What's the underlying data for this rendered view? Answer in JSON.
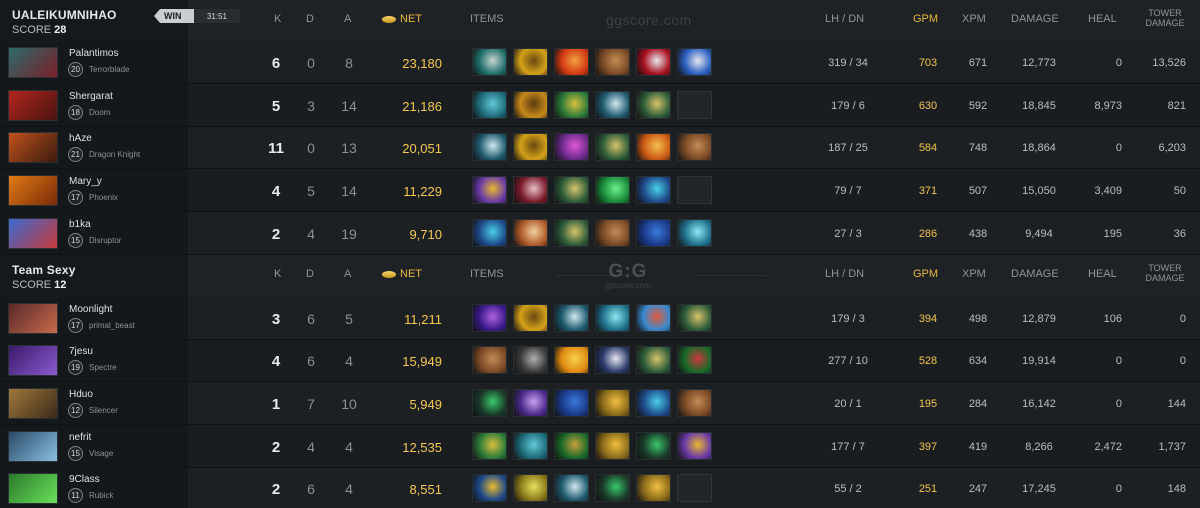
{
  "headers": {
    "k": "K",
    "d": "D",
    "a": "A",
    "net": "NET",
    "items": "ITEMS",
    "lhdn": "LH / DN",
    "gpm": "GPM",
    "xpm": "XPM",
    "damage": "DAMAGE",
    "heal": "HEAL",
    "tower_line1": "TOWER",
    "tower_line2": "DAMAGE"
  },
  "watermark": "ggscore.com",
  "logo": {
    "big": "G:G",
    "small": "ggscore.com"
  },
  "teams": [
    {
      "name": "UALEIKUMNIHAO",
      "score_label": "SCORE",
      "score": "28",
      "result": "WIN",
      "duration": "31:51",
      "players": [
        {
          "name": "Palantimos",
          "level": "20",
          "hero": "Terrorblade",
          "k": "6",
          "d": "0",
          "a": "8",
          "net": "23,180",
          "lhdn": "319 / 34",
          "gpm": "703",
          "xpm": "671",
          "damage": "12,773",
          "heal": "0",
          "tower": "13,526",
          "portrait": [
            "#2b6b6a",
            "#7a1f2a"
          ],
          "items": [
            [
              "#1f6f6a",
              "#c9d4d0"
            ],
            [
              "#d4a21a",
              "#6b4a10"
            ],
            [
              "#d33a12",
              "#f2a040"
            ],
            [
              "#7a4a26",
              "#c48a55"
            ],
            [
              "#a8101e",
              "#e8e8ee"
            ],
            [
              "#2a5fbf",
              "#e6e6f0"
            ]
          ]
        },
        {
          "name": "Shergarat",
          "level": "18",
          "hero": "Doom",
          "k": "5",
          "d": "3",
          "a": "14",
          "net": "21,186",
          "lhdn": "179 / 6",
          "gpm": "630",
          "xpm": "592",
          "damage": "18,845",
          "heal": "8,973",
          "tower": "821",
          "portrait": [
            "#b3261e",
            "#4a1410"
          ],
          "items": [
            [
              "#1e6b7a",
              "#63c8d8"
            ],
            [
              "#c8891a",
              "#5a3a10"
            ],
            [
              "#2c7a3a",
              "#d8c040"
            ],
            [
              "#1f5a6e",
              "#cfe8f0"
            ],
            [
              "#2e5c3a",
              "#d6c36a"
            ],
            null
          ]
        },
        {
          "name": "hAze",
          "level": "21",
          "hero": "Dragon Knight",
          "k": "11",
          "d": "0",
          "a": "13",
          "net": "20,051",
          "lhdn": "187 / 25",
          "gpm": "584",
          "xpm": "748",
          "damage": "18,864",
          "heal": "0",
          "tower": "6,203",
          "portrait": [
            "#c0521c",
            "#3a1a10"
          ],
          "items": [
            [
              "#1f5a6e",
              "#cfe8f0"
            ],
            [
              "#d4a21a",
              "#6b4a10"
            ],
            [
              "#6a2a8a",
              "#e058d8"
            ],
            [
              "#2e5c3a",
              "#d6c36a"
            ],
            [
              "#cc5a14",
              "#f4c050"
            ],
            [
              "#7a4a26",
              "#c48a55"
            ]
          ]
        },
        {
          "name": "Mary_y",
          "level": "17",
          "hero": "Phoenix",
          "k": "4",
          "d": "5",
          "a": "14",
          "net": "11,229",
          "lhdn": "79 / 7",
          "gpm": "371",
          "xpm": "507",
          "damage": "15,050",
          "heal": "3,409",
          "tower": "50",
          "portrait": [
            "#e07a14",
            "#7a2a0a"
          ],
          "items": [
            [
              "#6a3aa8",
              "#e8b830"
            ],
            [
              "#7a1a2a",
              "#e8c0c8"
            ],
            [
              "#2e5c3a",
              "#d6c36a"
            ],
            [
              "#1a8a3a",
              "#6af08a"
            ],
            [
              "#1e4a8a",
              "#4ad0e8"
            ],
            null
          ]
        },
        {
          "name": "b1ka",
          "level": "15",
          "hero": "Disruptor",
          "k": "2",
          "d": "4",
          "a": "19",
          "net": "9,710",
          "lhdn": "27 / 3",
          "gpm": "286",
          "xpm": "438",
          "damage": "9,494",
          "heal": "195",
          "tower": "36",
          "portrait": [
            "#3a6ad0",
            "#c83a3a"
          ],
          "items": [
            [
              "#1e4a8a",
              "#4ad0e8"
            ],
            [
              "#b05a2a",
              "#f0d0a0"
            ],
            [
              "#2e5c3a",
              "#d6c36a"
            ],
            [
              "#7a4a26",
              "#c48a55"
            ],
            [
              "#1a3a8a",
              "#3a7ad8"
            ],
            [
              "#1f6f8a",
              "#8ae8f0"
            ]
          ]
        }
      ]
    },
    {
      "name": "Team Sexy",
      "score_label": "SCORE",
      "score": "12",
      "players": [
        {
          "name": "Moonlight",
          "level": "17",
          "hero": "primal_beast",
          "k": "3",
          "d": "6",
          "a": "5",
          "net": "11,211",
          "lhdn": "179 / 3",
          "gpm": "394",
          "xpm": "498",
          "damage": "12,879",
          "heal": "106",
          "tower": "0",
          "portrait": [
            "#5a2a2a",
            "#c86a4a"
          ],
          "items": [
            [
              "#3a1a8a",
              "#b060e0"
            ],
            [
              "#d4a21a",
              "#6b4a10"
            ],
            [
              "#1f5a6e",
              "#cfe8f0"
            ],
            [
              "#1f6f8a",
              "#8ae8f0"
            ],
            [
              "#3a8ad0",
              "#e05a3a"
            ],
            [
              "#2e5c3a",
              "#d6c36a"
            ]
          ]
        },
        {
          "name": "7jesu",
          "level": "19",
          "hero": "Spectre",
          "k": "4",
          "d": "6",
          "a": "4",
          "net": "15,949",
          "lhdn": "277 / 10",
          "gpm": "528",
          "xpm": "634",
          "damage": "19,914",
          "heal": "0",
          "tower": "0",
          "portrait": [
            "#3a1a6a",
            "#8a5ad0"
          ],
          "items": [
            [
              "#7a4a26",
              "#c48a55"
            ],
            [
              "#3a3a3a",
              "#b0b0b0"
            ],
            [
              "#e08a10",
              "#f8d050"
            ],
            [
              "#2a3a6a",
              "#e6e6f0"
            ],
            [
              "#2e5c3a",
              "#d6c36a"
            ],
            [
              "#1a6a2a",
              "#c83a3a"
            ]
          ]
        },
        {
          "name": "Hduo",
          "level": "12",
          "hero": "Silencer",
          "k": "1",
          "d": "7",
          "a": "10",
          "net": "5,949",
          "lhdn": "20 / 1",
          "gpm": "195",
          "xpm": "284",
          "damage": "16,142",
          "heal": "0",
          "tower": "144",
          "portrait": [
            "#a0783a",
            "#3a2a1a"
          ],
          "items": [
            [
              "#1a3a2a",
              "#3ac86a"
            ],
            [
              "#4a2a8a",
              "#c8a0f0"
            ],
            [
              "#1a3a8a",
              "#3a7ad8"
            ],
            [
              "#8a6a1a",
              "#f0c040"
            ],
            [
              "#1e4a8a",
              "#4ad0e8"
            ],
            [
              "#7a4a26",
              "#c48a55"
            ]
          ]
        },
        {
          "name": "nefrit",
          "level": "15",
          "hero": "Visage",
          "k": "2",
          "d": "4",
          "a": "4",
          "net": "12,535",
          "lhdn": "177 / 7",
          "gpm": "397",
          "xpm": "419",
          "damage": "8,266",
          "heal": "2,472",
          "tower": "1,737",
          "portrait": [
            "#2a4a6a",
            "#8ac0e0"
          ],
          "items": [
            [
              "#2c7a3a",
              "#d8c040"
            ],
            [
              "#1e6b7a",
              "#63c8d8"
            ],
            [
              "#1a6a2a",
              "#c8a03a"
            ],
            [
              "#8a6a1a",
              "#f0c040"
            ],
            [
              "#1a3a2a",
              "#3ac86a"
            ],
            [
              "#6a3aa8",
              "#e8b830"
            ]
          ]
        },
        {
          "name": "9Class",
          "level": "11",
          "hero": "Rubick",
          "k": "2",
          "d": "6",
          "a": "4",
          "net": "8,551",
          "lhdn": "55 / 2",
          "gpm": "251",
          "xpm": "247",
          "damage": "17,245",
          "heal": "0",
          "tower": "148",
          "portrait": [
            "#2a7a2a",
            "#6ae05a"
          ],
          "items": [
            [
              "#1e4a8a",
              "#e8b830"
            ],
            [
              "#8a7a1a",
              "#e8e060"
            ],
            [
              "#1f5a6e",
              "#cfe8f0"
            ],
            [
              "#1a3a2a",
              "#3ac86a"
            ],
            [
              "#8a6a1a",
              "#f0c040"
            ],
            null
          ]
        }
      ]
    }
  ]
}
